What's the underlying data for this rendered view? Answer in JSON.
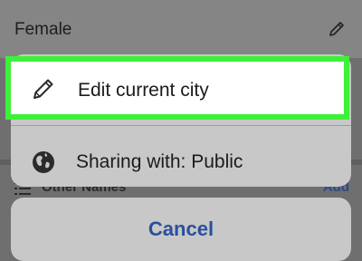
{
  "background": {
    "field_value": "Female",
    "section_label": "Other Names",
    "section_action": "Add"
  },
  "sheet": {
    "actions": [
      {
        "label": "Edit current city",
        "icon": "pencil-icon"
      },
      {
        "label": "Sharing with: Public",
        "icon": "globe-icon"
      }
    ],
    "cancel_label": "Cancel"
  },
  "colors": {
    "highlight": "#3ef03a",
    "cancel_text": "#2a4f9c",
    "sheet_bg": "#c8c8c8"
  }
}
